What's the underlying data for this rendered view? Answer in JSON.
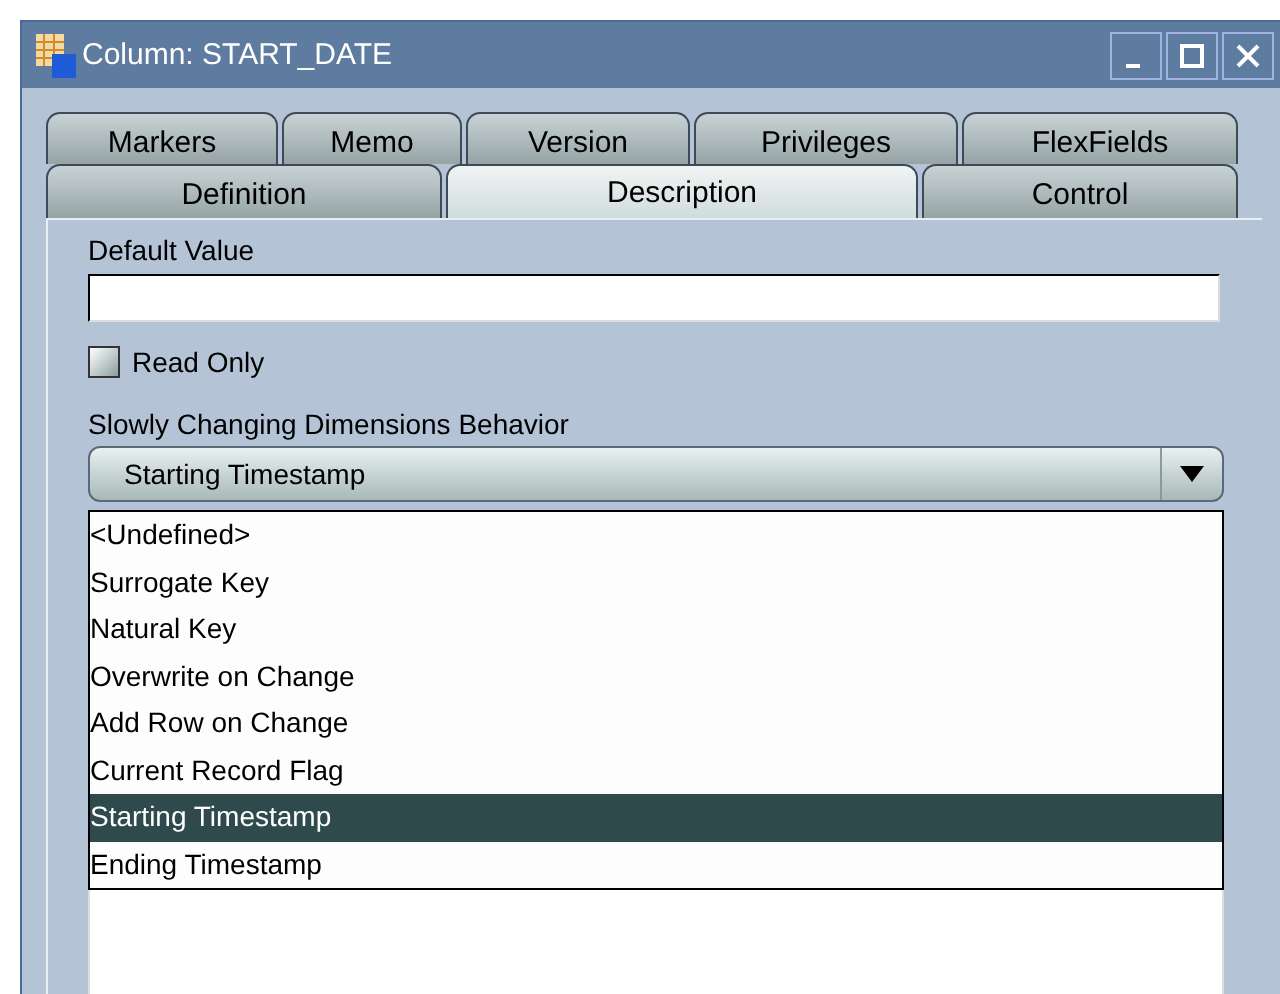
{
  "window": {
    "title": "Column: START_DATE"
  },
  "tab_rows": [
    [
      {
        "label": "Markers",
        "selected": false
      },
      {
        "label": "Memo",
        "selected": false
      },
      {
        "label": "Version",
        "selected": false
      },
      {
        "label": "Privileges",
        "selected": false
      },
      {
        "label": "FlexFields",
        "selected": false
      }
    ],
    [
      {
        "label": "Definition",
        "selected": false
      },
      {
        "label": "Description",
        "selected": true
      },
      {
        "label": "Control",
        "selected": false
      }
    ]
  ],
  "default_value": {
    "label": "Default Value"
  },
  "read_only": {
    "label": "Read Only",
    "checked": false
  },
  "scd": {
    "label": "Slowly Changing Dimensions Behavior",
    "value": "Starting Timestamp",
    "expanded": true,
    "options": [
      {
        "label": "<Undefined>",
        "selected": false
      },
      {
        "label": "Surrogate Key",
        "selected": false
      },
      {
        "label": "Natural Key",
        "selected": false
      },
      {
        "label": "Overwrite on Change",
        "selected": false
      },
      {
        "label": "Add Row on Change",
        "selected": false
      },
      {
        "label": "Current Record Flag",
        "selected": false
      },
      {
        "label": "Starting Timestamp",
        "selected": true
      },
      {
        "label": "Ending Timestamp",
        "selected": false
      }
    ]
  }
}
